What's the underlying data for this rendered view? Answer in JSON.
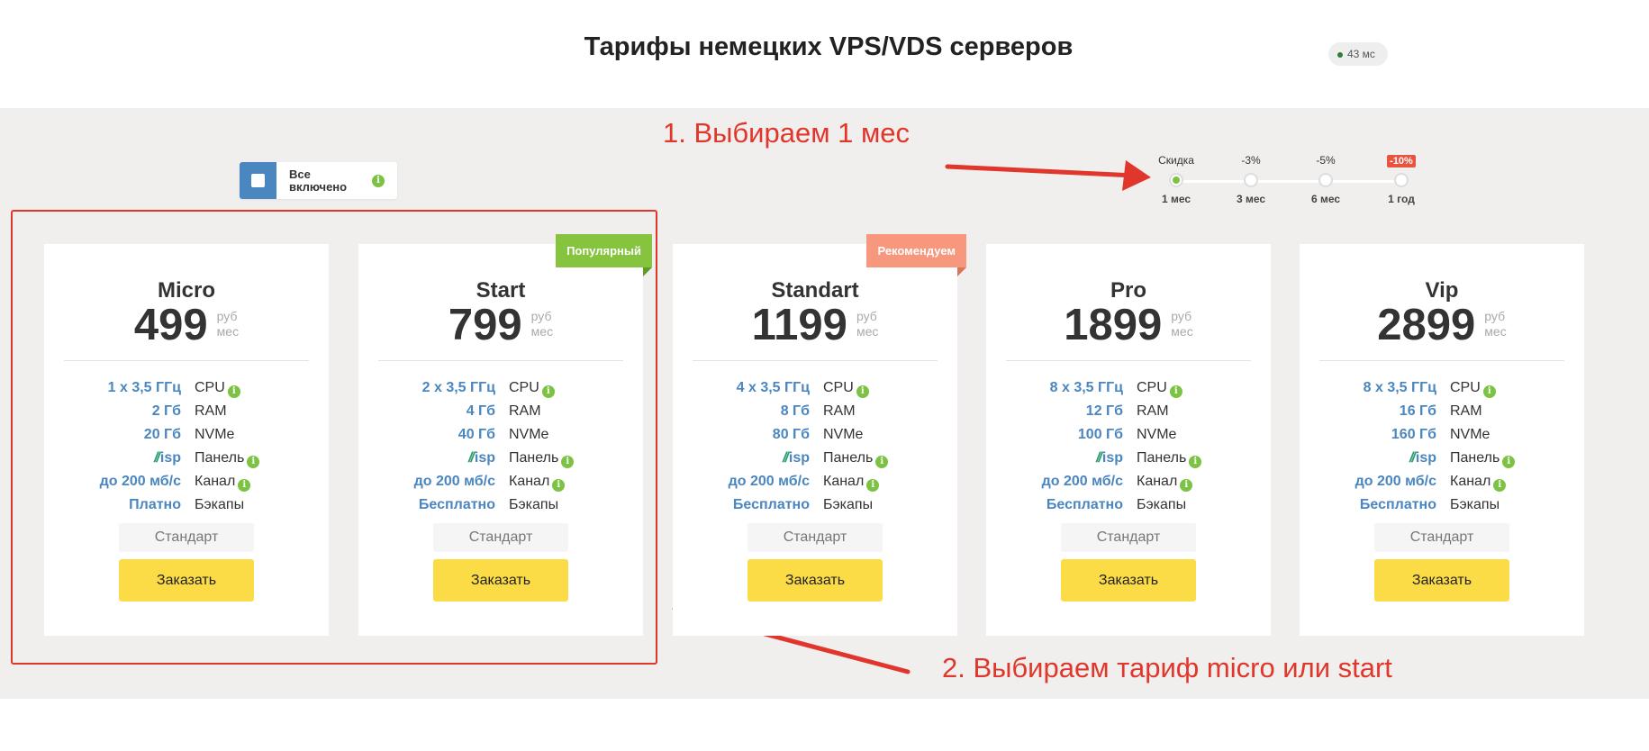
{
  "header": {
    "title": "Тарифы немецких VPS/VDS серверов",
    "ping": "43 мс"
  },
  "toggle": {
    "label": "Все включено",
    "info_icon": "info-icon"
  },
  "periods": [
    {
      "top": "Скидка",
      "bottom": "1 мес",
      "active": true
    },
    {
      "top": "-3%",
      "bottom": "3 мес",
      "active": false
    },
    {
      "top": "-5%",
      "bottom": "6 мес",
      "active": false
    },
    {
      "top": "-10%",
      "bottom": "1 год",
      "active": false
    }
  ],
  "annotations": {
    "step1": "1. Выбираем 1 мес",
    "step2": "2. Выбираем тариф micro или start",
    "color": "#e0362b"
  },
  "colors": {
    "accent_blue": "#4a86c0",
    "button_yellow": "#fcdc46",
    "ribbon_green": "#86c440",
    "ribbon_salmon": "#f7977d",
    "info_green": "#7cc243"
  },
  "spec_keys": {
    "cpu": "CPU",
    "ram": "RAM",
    "disk": "NVMe",
    "panel": "Панель",
    "isp": "isp",
    "channel": "Канал",
    "backups": "Бэкапы"
  },
  "price_unit": {
    "line1": "руб",
    "line2": "мес"
  },
  "buttons": {
    "standard": "Стандарт",
    "order": "Заказать"
  },
  "plans": [
    {
      "name": "Micro",
      "price": "499",
      "cpu": "1 x 3,5 ГГц",
      "ram": "2 Гб",
      "disk": "20 Гб",
      "channel": "до 200 мб/с",
      "backups": "Платно",
      "ribbon": ""
    },
    {
      "name": "Start",
      "price": "799",
      "cpu": "2 x 3,5 ГГц",
      "ram": "4 Гб",
      "disk": "40 Гб",
      "channel": "до 200 мб/с",
      "backups": "Бесплатно",
      "ribbon": "Популярный"
    },
    {
      "name": "Standart",
      "price": "1199",
      "cpu": "4 x 3,5 ГГц",
      "ram": "8 Гб",
      "disk": "80 Гб",
      "channel": "до 200 мб/с",
      "backups": "Бесплатно",
      "ribbon": "Рекомендуем"
    },
    {
      "name": "Pro",
      "price": "1899",
      "cpu": "8 x 3,5 ГГц",
      "ram": "12 Гб",
      "disk": "100 Гб",
      "channel": "до 200 мб/с",
      "backups": "Бесплатно",
      "ribbon": ""
    },
    {
      "name": "Vip",
      "price": "2899",
      "cpu": "8 x 3,5 ГГц",
      "ram": "16 Гб",
      "disk": "160 Гб",
      "channel": "до 200 мб/с",
      "backups": "Бесплатно",
      "ribbon": ""
    }
  ]
}
